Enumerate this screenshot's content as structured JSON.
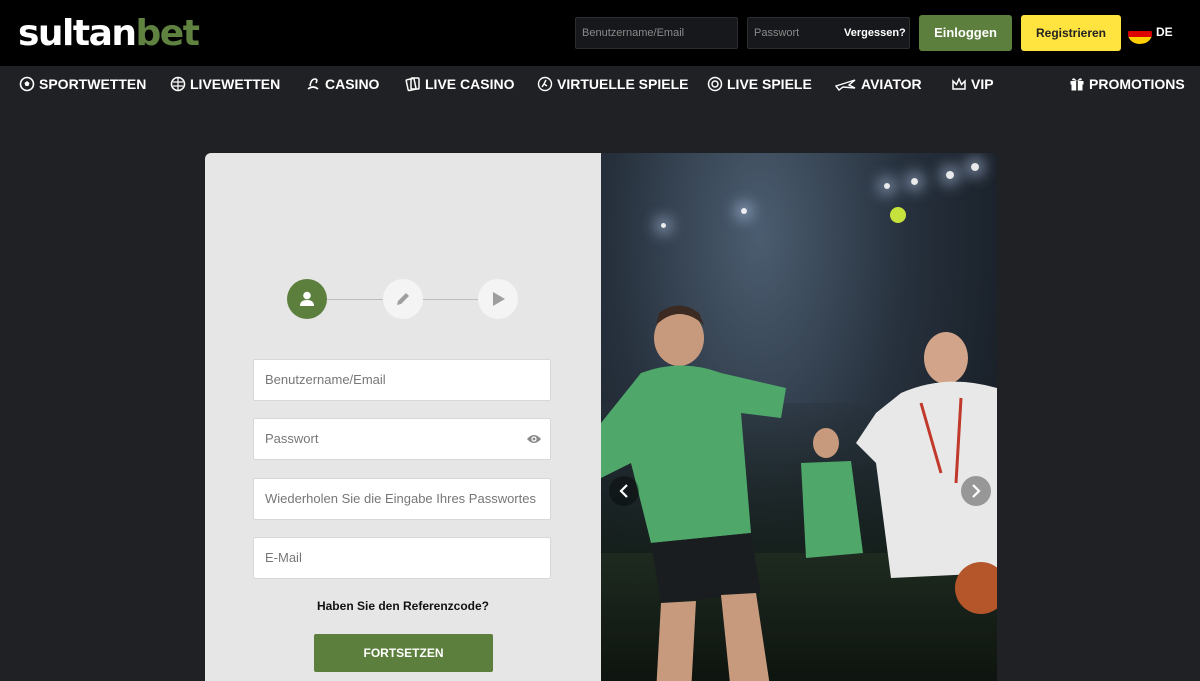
{
  "brand": {
    "logo_part1": "sultan",
    "logo_part2": "bet",
    "accent": "#5d7f3e",
    "register_color": "#ffe33f"
  },
  "header": {
    "username_placeholder": "Benutzername/Email",
    "password_placeholder": "Passwort",
    "forgot_label": "Vergessen?",
    "login_label": "Einloggen",
    "register_label": "Registrieren",
    "language_code": "DE",
    "language_flag_icon": "germany-flag-icon"
  },
  "nav": {
    "items": [
      {
        "label": "SPORTWETTEN",
        "icon": "soccer-ball-icon"
      },
      {
        "label": "LIVEWETTEN",
        "icon": "live-ball-icon"
      },
      {
        "label": "CASINO",
        "icon": "casino-chip-icon"
      },
      {
        "label": "LIVE CASINO",
        "icon": "cards-icon"
      },
      {
        "label": "VIRTUELLE SPIELE",
        "icon": "runner-icon"
      },
      {
        "label": "LIVE SPIELE",
        "icon": "live-games-icon"
      },
      {
        "label": "AVIATOR",
        "icon": "plane-icon"
      },
      {
        "label": "VIP",
        "icon": "crown-icon"
      }
    ],
    "promotions": {
      "label": "PROMOTIONS",
      "icon": "gift-icon"
    }
  },
  "registration": {
    "steps": [
      {
        "icon": "user-icon",
        "active": true
      },
      {
        "icon": "pencil-icon",
        "active": false
      },
      {
        "icon": "play-icon",
        "active": false
      }
    ],
    "fields": {
      "username_placeholder": "Benutzername/Email",
      "password_placeholder": "Passwort",
      "password_repeat_placeholder": "Wiederholen Sie die Eingabe Ihres Passwortes",
      "email_placeholder": "E-Mail"
    },
    "referral_label": "Haben Sie den Referenzcode?",
    "continue_label": "FORTSETZEN"
  },
  "slider": {
    "prev_icon": "chevron-left-icon",
    "next_icon": "chevron-right-icon"
  }
}
